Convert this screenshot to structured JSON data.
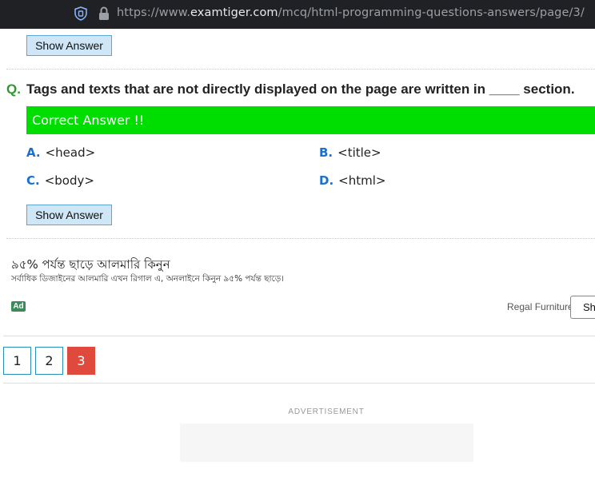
{
  "browser": {
    "url_prefix": "https://www.",
    "url_domain": "examtiger.com",
    "url_path": "/mcq/html-programming-questions-answers/page/3/"
  },
  "top_button": {
    "label": "Show Answer"
  },
  "question": {
    "marker": "Q.",
    "text": "Tags and texts that are not directly displayed on the page are written in ____ section.",
    "correct_banner": "Correct Answer !!",
    "options": [
      {
        "letter": "A.",
        "text": "<head>"
      },
      {
        "letter": "B.",
        "text": "<title>"
      },
      {
        "letter": "C.",
        "text": "<body>"
      },
      {
        "letter": "D.",
        "text": "<html>"
      }
    ],
    "show_answer": "Show Answer"
  },
  "ad": {
    "title": "৯৫% পর্যন্ত ছাড়ে আলমারি কিনুন",
    "description": "সর্বাধিক ডিজাইনের আলমারি এখন রিগাল এ, অনলাইনে কিনুন ৯৫% পর্যন্ত ছাড়ে।",
    "badge": "Ad",
    "advertiser": "Regal Furniture",
    "button": "Sh"
  },
  "pagination": {
    "pages": [
      "1",
      "2",
      "3"
    ],
    "current": "3"
  },
  "advertisement_label": "ADVERTISEMENT",
  "colors": {
    "correct_banner": "#00dd00",
    "option_letter": "#1a6fd1",
    "question_marker": "#2e9a2e",
    "active_page": "#e04a3c"
  }
}
